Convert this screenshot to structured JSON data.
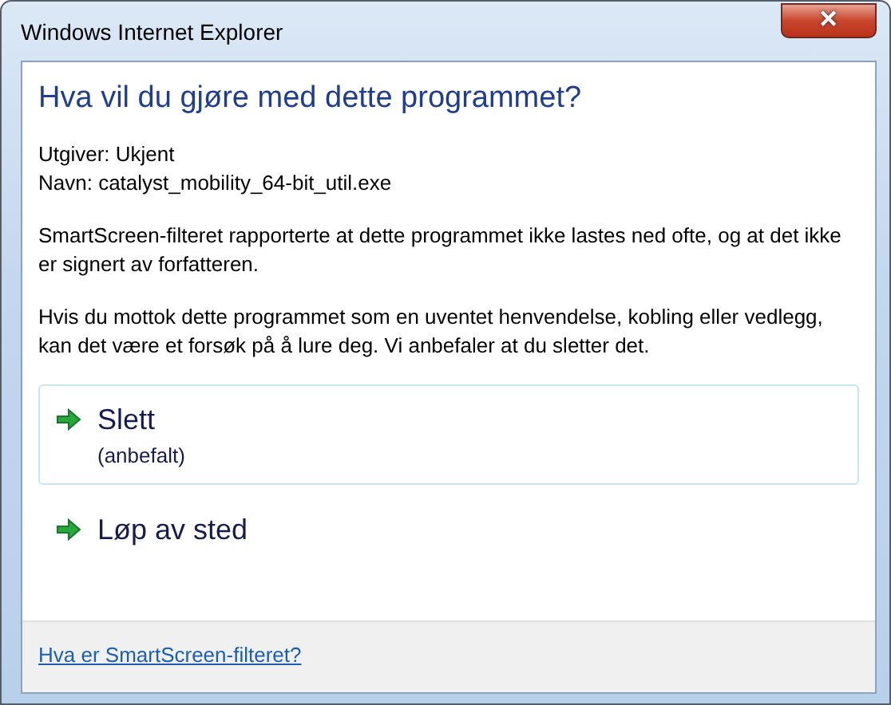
{
  "window": {
    "title": "Windows Internet Explorer",
    "close": "✕"
  },
  "heading": "Hva vil du gjøre med dette programmet?",
  "details": [
    "Utgiver: Ukjent",
    "Navn: catalyst_mobility_64-bit_util.exe"
  ],
  "paragraphs": [
    "SmartScreen-filteret rapporterte at dette programmet ikke lastes ned ofte, og at det ikke er signert av forfatteren.",
    "Hvis du mottok dette programmet som en uventet henvendelse, kobling eller vedlegg, kan det være et forsøk på å lure deg. Vi anbefaler at du sletter det."
  ],
  "options": [
    {
      "label": "Slett",
      "note": "(anbefalt)",
      "selected": true
    },
    {
      "label": "Løp av sted",
      "selected": false
    }
  ],
  "footer_link": "Hva er SmartScreen-filteret?"
}
